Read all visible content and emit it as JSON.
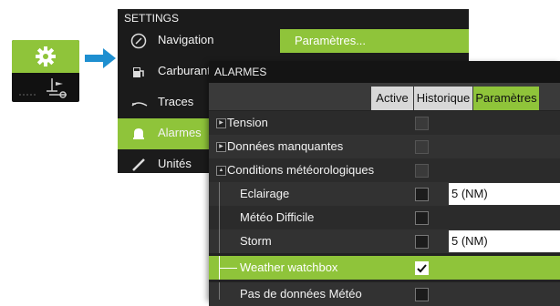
{
  "settings": {
    "title": "SETTINGS",
    "items": [
      {
        "label": "Navigation",
        "icon": "compass-icon"
      },
      {
        "label": "Carburant",
        "icon": "fuel-icon"
      },
      {
        "label": "Traces",
        "icon": "tracks-icon"
      },
      {
        "label": "Alarmes",
        "icon": "bell-icon"
      },
      {
        "label": "Unités",
        "icon": "ruler-icon"
      }
    ],
    "submenu_label": "Paramètres..."
  },
  "alarms": {
    "title": "ALARMES",
    "tabs": [
      {
        "label": "Active"
      },
      {
        "label": "Historique"
      },
      {
        "label": "Paramètres"
      }
    ],
    "rows": [
      {
        "label": "Tension"
      },
      {
        "label": "Données manquantes"
      },
      {
        "label": "Conditions météorologiques"
      },
      {
        "label": "Eclairage",
        "value": "5 (NM)"
      },
      {
        "label": "Météo Difficile"
      },
      {
        "label": "Storm",
        "value": "5 (NM)"
      },
      {
        "label": "Weather watchbox",
        "checked": true
      },
      {
        "label": "Pas de données Météo"
      }
    ]
  },
  "colors": {
    "accent": "#8fc43a",
    "arrow": "#1e8fd0",
    "panel": "#1b1b1b"
  }
}
